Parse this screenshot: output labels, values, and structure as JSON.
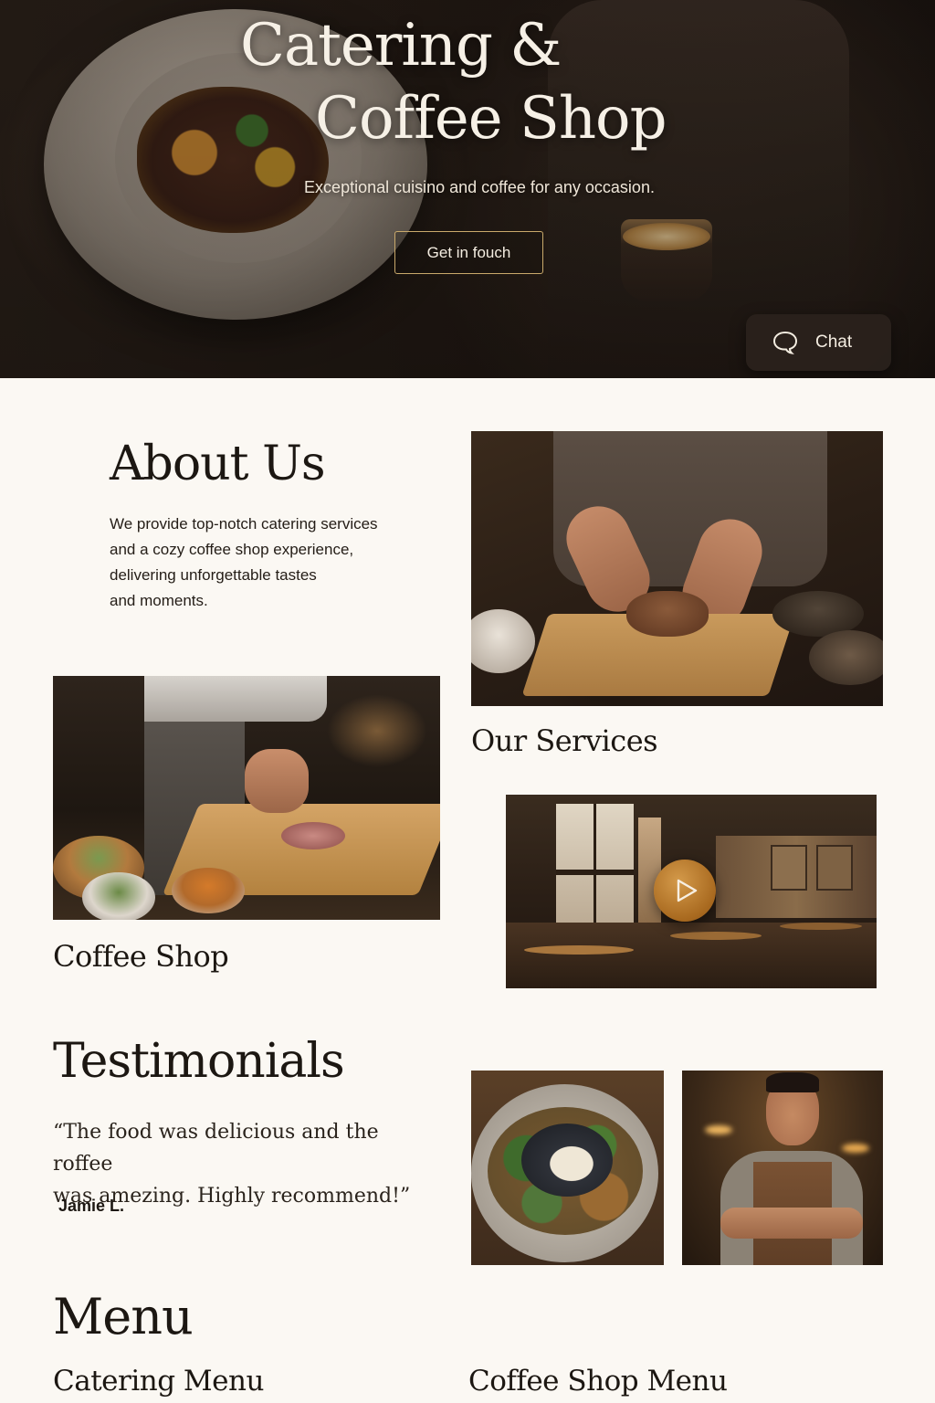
{
  "hero": {
    "title_line1": "Catering &",
    "title_line2": "Coffee Shop",
    "subtitle": "Exceptional cuisino and coffee for any occasion.",
    "cta_label": "Get in fouch",
    "chat_label": "Chat",
    "chat_icon": "speech-bubble-icon",
    "accent_color": "#c9a96b"
  },
  "about": {
    "title": "About Us",
    "text_lines": [
      "We provide top-notch catering services",
      "and a cozy coffee shop experience,",
      "delivering unforgettable tastes",
      "and moments."
    ]
  },
  "services": {
    "title": "Our Services",
    "video_icon": "play-icon"
  },
  "coffee_shop": {
    "title": "Coffee Shop"
  },
  "testimonials": {
    "title": "Testimonials",
    "quote_lines": [
      "“The food was delicious and the roffee",
      "was amezing. Highly recommend!”"
    ],
    "author": "Jamie L."
  },
  "menu": {
    "title": "Menu",
    "columns": [
      "Catering Menu",
      "Coffee Shop Menu"
    ]
  },
  "colors": {
    "page_background": "#fbf8f3",
    "text": "#1c1712",
    "play_button": "#b87a2c"
  }
}
